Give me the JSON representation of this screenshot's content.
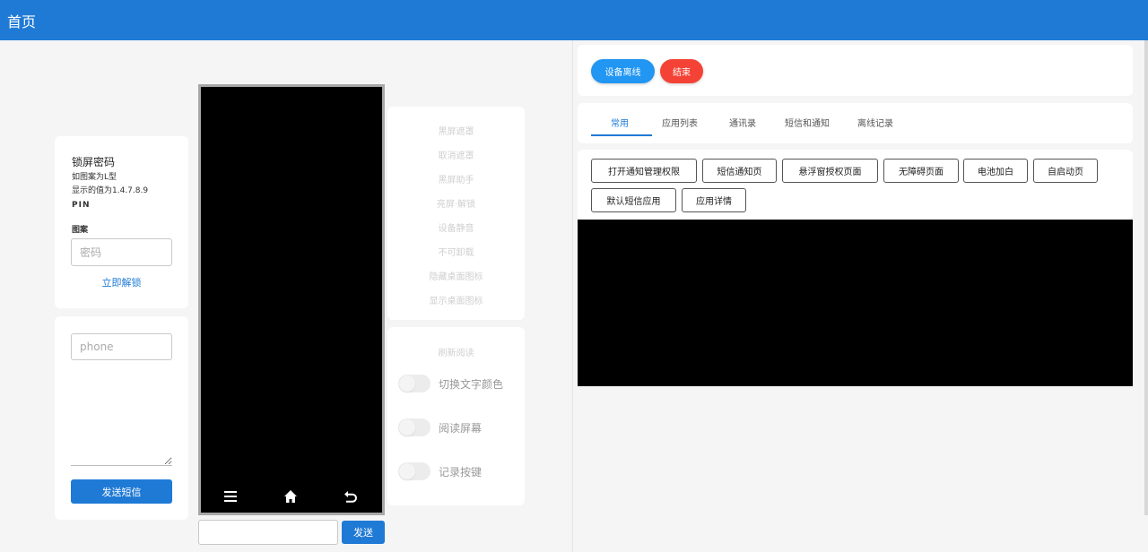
{
  "header": {
    "title": "首页"
  },
  "lock": {
    "title": "锁屏密码",
    "hint_pattern": "如图案为L型",
    "hint_value": "显示的值为1.4.7.8.9",
    "pin_label": "PIN",
    "pattern_label": "图案",
    "password_placeholder": "密码",
    "unlock_label": "立即解锁"
  },
  "sms": {
    "phone_placeholder": "phone",
    "send_label": "发送短信"
  },
  "phone_nav": {
    "menu_icon": "menu-icon",
    "home_icon": "home-icon",
    "back_icon": "back-icon"
  },
  "command": {
    "send_label": "发送"
  },
  "controls": {
    "items": [
      "黑屏遮罩",
      "取消遮罩",
      "黑屏助手",
      "亮屏·解锁",
      "设备静音",
      "不可卸载",
      "隐藏桌面图标",
      "显示桌面图标"
    ]
  },
  "reading": {
    "refresh_label": "刷新阅读",
    "toggles": [
      {
        "label": "切换文字颜色",
        "on": false
      },
      {
        "label": "阅读屏幕",
        "on": false
      },
      {
        "label": "记录按键",
        "on": false
      }
    ]
  },
  "device": {
    "offline_label": "设备离线",
    "end_label": "结束",
    "offline_color": "#2196f3",
    "end_color": "#f44336"
  },
  "tabs": [
    {
      "label": "常用",
      "active": true
    },
    {
      "label": "应用列表",
      "active": false
    },
    {
      "label": "通讯录",
      "active": false
    },
    {
      "label": "短信和通知",
      "active": false
    },
    {
      "label": "离线记录",
      "active": false
    }
  ],
  "actions": [
    "打开通知管理权限",
    "短信通知页",
    "悬浮窗授权页面",
    "无障碍页面",
    "电池加白",
    "自启动页",
    "默认短信应用",
    "应用详情"
  ],
  "colors": {
    "primary": "#1f7ad6"
  }
}
